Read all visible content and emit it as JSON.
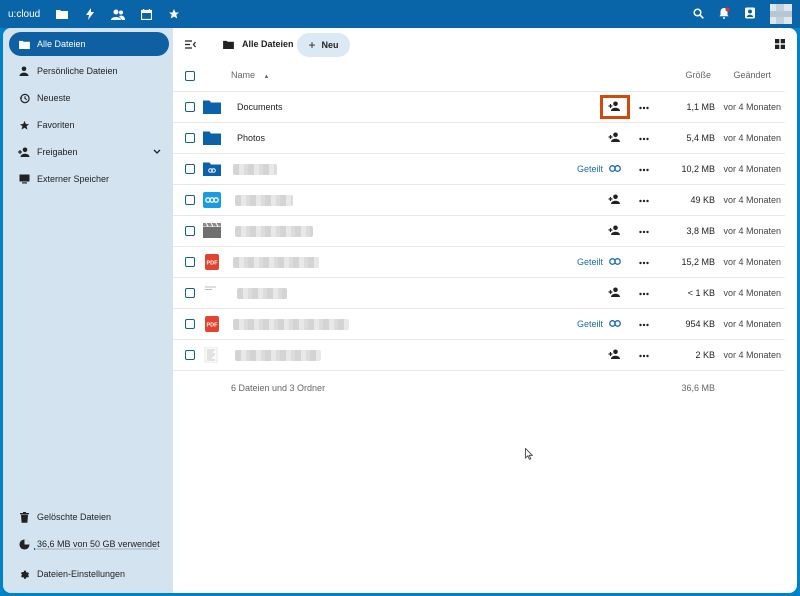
{
  "topbar": {
    "brand": "u:cloud",
    "apps": [
      "files-icon",
      "activity-icon",
      "contacts-icon",
      "calendar-icon",
      "favorites-icon"
    ],
    "right_icons": [
      "search-icon",
      "notifications-icon",
      "contacts-menu-icon",
      "avatar"
    ]
  },
  "sidebar": {
    "items": [
      {
        "label": "Alle Dateien",
        "icon": "folder-icon",
        "active": true
      },
      {
        "label": "Persönliche Dateien",
        "icon": "user-icon"
      },
      {
        "label": "Neueste",
        "icon": "history-icon"
      },
      {
        "label": "Favoriten",
        "icon": "star-icon"
      },
      {
        "label": "Freigaben",
        "icon": "share-icon"
      },
      {
        "label": "Externer Speicher",
        "icon": "monitor-icon"
      }
    ],
    "bottom": {
      "trash": "Gelöschte Dateien",
      "quota": "36,6 MB von 50 GB verwendet",
      "quota_fraction": 0.0007,
      "settings": "Dateien-Einstellungen"
    }
  },
  "toolbar": {
    "breadcrumb": "Alle Dateien",
    "new_label": "Neu"
  },
  "table": {
    "col_name": "Name",
    "col_size": "Größe",
    "col_modified": "Geändert",
    "rows": [
      {
        "name": "Documents",
        "type": "folder",
        "size": "1,1 MB",
        "modified": "vor 4 Monaten",
        "shared": "",
        "highlight": true
      },
      {
        "name": "Photos",
        "type": "folder",
        "size": "5,4 MB",
        "modified": "vor 4 Monaten",
        "shared": ""
      },
      {
        "name": "",
        "type": "shared-folder",
        "size": "10,2 MB",
        "modified": "vor 4 Monaten",
        "shared": "Geteilt"
      },
      {
        "name": "",
        "type": "app-file",
        "size": "49 KB",
        "modified": "vor 4 Monaten",
        "shared": ""
      },
      {
        "name": "",
        "type": "video",
        "size": "3,8 MB",
        "modified": "vor 4 Monaten",
        "shared": ""
      },
      {
        "name": "",
        "type": "pdf",
        "size": "15,2 MB",
        "modified": "vor 4 Monaten",
        "shared": "Geteilt"
      },
      {
        "name": "",
        "type": "text",
        "size": "< 1 KB",
        "modified": "vor 4 Monaten",
        "shared": ""
      },
      {
        "name": "",
        "type": "pdf",
        "size": "954 KB",
        "modified": "vor 4 Monaten",
        "shared": "Geteilt"
      },
      {
        "name": "",
        "type": "document",
        "size": "2 KB",
        "modified": "vor 4 Monaten",
        "shared": ""
      }
    ],
    "summary": "6 Dateien und 3 Ordner",
    "summary_size": "36,6 MB"
  },
  "colors": {
    "topbar": "#0a64a8",
    "sidebar": "#d3e4f0",
    "accent": "#0f5fa3",
    "highlight": "#d04a0c"
  }
}
